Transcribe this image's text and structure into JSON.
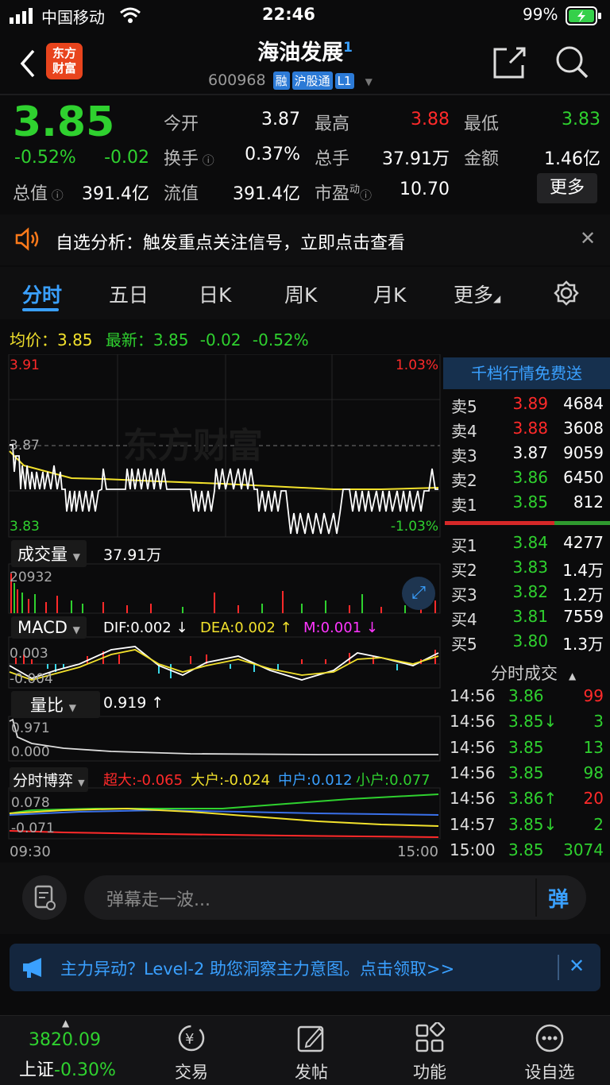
{
  "status_bar": {
    "carrier": "中国移动",
    "time": "22:46",
    "battery": "99%"
  },
  "header": {
    "logo_line1": "东方",
    "logo_line2": "财富",
    "title": "海油发展",
    "title_badge": "1",
    "code": "600968",
    "tags": [
      "融",
      "沪股通",
      "L1"
    ]
  },
  "quote": {
    "price": "3.85",
    "change_pct": "-0.52%",
    "change": "-0.02",
    "open_label": "今开",
    "open": "3.87",
    "high_label": "最高",
    "high": "3.88",
    "low_label": "最低",
    "low": "3.83",
    "turnover_label": "换手",
    "turnover": "0.37%",
    "volume_label": "总手",
    "volume": "37.91万",
    "amount_label": "金额",
    "amount": "1.46亿",
    "mktcap_label": "总值",
    "mktcap": "391.4亿",
    "float_label": "流值",
    "float": "391.4亿",
    "pe_label": "市盈",
    "pe_sup": "动",
    "pe": "10.70",
    "more": "更多"
  },
  "notice": {
    "text": "自选分析：触发重点关注信号，立即点击查看"
  },
  "tabs": [
    "分时",
    "五日",
    "日K",
    "周K",
    "月K",
    "更多"
  ],
  "info_line": {
    "avg_label": "均价：",
    "avg": "3.85",
    "latest_label": "最新：",
    "latest": "3.85",
    "chg": "-0.02",
    "pct": "-0.52%"
  },
  "chart": {
    "ymax": "3.91",
    "ymid": "3.87",
    "ymin": "3.83",
    "pct_top": "1.03%",
    "pct_bot": "-1.03%",
    "watermark": "东方财富",
    "vol_label": "成交量",
    "vol_total": "37.91万",
    "vol_max": "20932",
    "macd_label": "MACD",
    "dif": "DIF:0.002 ↓",
    "dea": "DEA:0.002 ↑",
    "m": "M:0.001 ↓",
    "macd_top": "0.003",
    "macd_bot": "-0.004",
    "lb_label": "量比",
    "lb_val": "0.919 ↑",
    "lb_top": "0.971",
    "lb_bot": "0.000",
    "by_label": "分时博弈",
    "by_super": "超大:-0.065",
    "by_big": "大户:-0.024",
    "by_mid": "中户:0.012",
    "by_small": "小户:0.077",
    "by_top": "0.078",
    "by_bot": "-0.071",
    "t_start": "09:30",
    "t_end": "15:00"
  },
  "orderbook": {
    "banner": "千档行情免费送",
    "asks": [
      {
        "label": "卖5",
        "price": "3.89",
        "vol": "4684",
        "color": "red"
      },
      {
        "label": "卖4",
        "price": "3.88",
        "vol": "3608",
        "color": "red"
      },
      {
        "label": "卖3",
        "price": "3.87",
        "vol": "9059",
        "color": "white"
      },
      {
        "label": "卖2",
        "price": "3.86",
        "vol": "6450",
        "color": "green"
      },
      {
        "label": "卖1",
        "price": "3.85",
        "vol": "812",
        "color": "green"
      }
    ],
    "bids": [
      {
        "label": "买1",
        "price": "3.84",
        "vol": "4277"
      },
      {
        "label": "买2",
        "price": "3.83",
        "vol": "1.4万"
      },
      {
        "label": "买3",
        "price": "3.82",
        "vol": "1.2万"
      },
      {
        "label": "买4",
        "price": "3.81",
        "vol": "7559"
      },
      {
        "label": "买5",
        "price": "3.80",
        "vol": "1.3万"
      }
    ]
  },
  "trades": {
    "title": "分时成交",
    "rows": [
      {
        "t": "14:56",
        "p": "3.86",
        "v": "99",
        "pc": "green",
        "vc": "red"
      },
      {
        "t": "14:56",
        "p": "3.85↓",
        "v": "3",
        "pc": "green",
        "vc": "green"
      },
      {
        "t": "14:56",
        "p": "3.85",
        "v": "13",
        "pc": "green",
        "vc": "green"
      },
      {
        "t": "14:56",
        "p": "3.85",
        "v": "98",
        "pc": "green",
        "vc": "green"
      },
      {
        "t": "14:56",
        "p": "3.86↑",
        "v": "20",
        "pc": "green",
        "vc": "red"
      },
      {
        "t": "14:57",
        "p": "3.85↓",
        "v": "2",
        "pc": "green",
        "vc": "green"
      },
      {
        "t": "15:00",
        "p": "3.85",
        "v": "3074",
        "pc": "green",
        "vc": "green"
      }
    ]
  },
  "comment": {
    "placeholder": "弹幕走一波...",
    "btn": "弹"
  },
  "ad": {
    "text": "主力异动？Level-2 助您洞察主力意图。点击领取>>"
  },
  "bottom": {
    "index_val": "3820.09",
    "index_name": "上证",
    "index_pct": "-0.30%",
    "items": [
      "交易",
      "发帖",
      "功能",
      "设自选"
    ]
  }
}
